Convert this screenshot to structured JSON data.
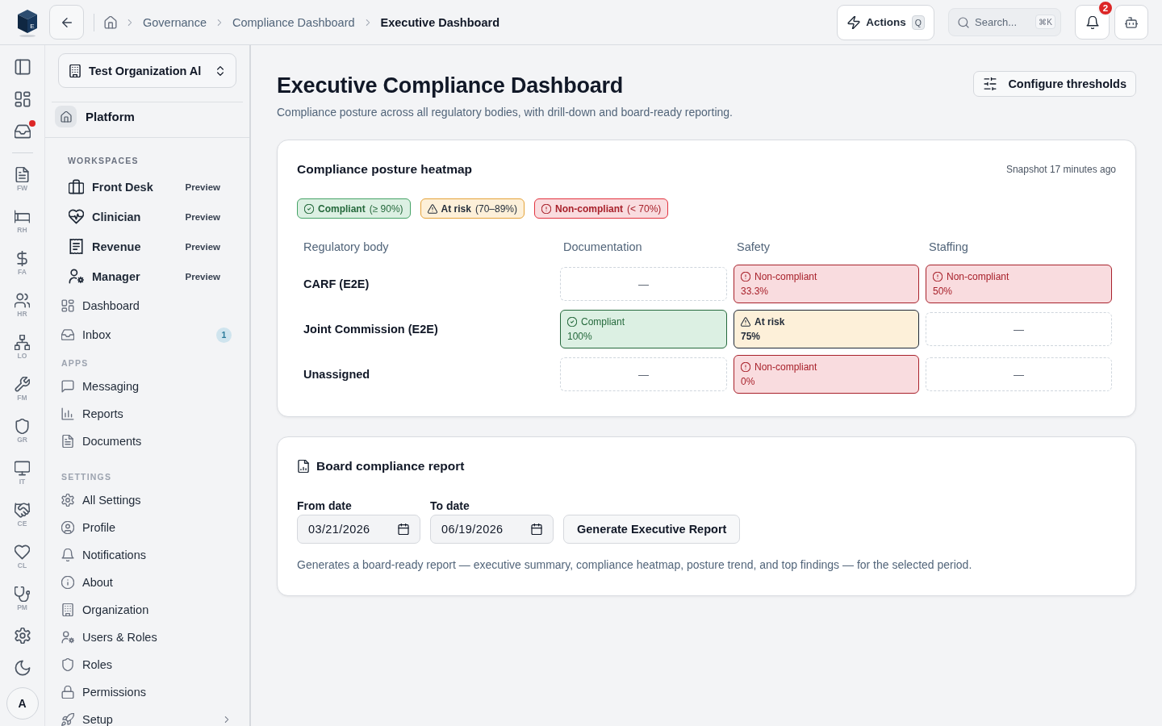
{
  "topbar": {
    "logo": "E",
    "breadcrumbs": [
      {
        "label": "Governance",
        "current": false
      },
      {
        "label": "Compliance Dashboard",
        "current": false
      },
      {
        "label": "Executive Dashboard",
        "current": true
      }
    ],
    "actions": {
      "label": "Actions",
      "shortcut": "Q"
    },
    "search": {
      "placeholder": "Search...",
      "shortcut": "⌘K"
    },
    "notifications": {
      "count": "2"
    }
  },
  "rail": {
    "inbox_unread": true,
    "apps": [
      {
        "label": "FW"
      },
      {
        "label": "RH"
      },
      {
        "label": "FA"
      },
      {
        "label": "HR"
      },
      {
        "label": "LO"
      },
      {
        "label": "FM"
      },
      {
        "label": "GR"
      },
      {
        "label": "IT"
      },
      {
        "label": "CE"
      },
      {
        "label": "CL"
      },
      {
        "label": "PM"
      }
    ],
    "avatar": "A"
  },
  "sidebar": {
    "organization": "Test Organization Al",
    "platform": "Platform",
    "workspaces": {
      "heading": "WORKSPACES",
      "items": [
        {
          "label": "Front Desk",
          "tag": "Preview"
        },
        {
          "label": "Clinician",
          "tag": "Preview"
        },
        {
          "label": "Revenue",
          "tag": "Preview"
        },
        {
          "label": "Manager",
          "tag": "Preview"
        }
      ]
    },
    "nav": [
      {
        "label": "Dashboard"
      },
      {
        "label": "Inbox",
        "badge": "1"
      }
    ],
    "sections": [
      {
        "heading": "APPS",
        "items": [
          {
            "label": "Messaging"
          },
          {
            "label": "Reports"
          },
          {
            "label": "Documents"
          }
        ]
      },
      {
        "heading": "SETTINGS",
        "items": [
          {
            "label": "All Settings"
          },
          {
            "label": "Profile"
          },
          {
            "label": "Notifications"
          },
          {
            "label": "About"
          },
          {
            "label": "Organization"
          },
          {
            "label": "Users & Roles"
          },
          {
            "label": "Roles"
          },
          {
            "label": "Permissions"
          },
          {
            "label": "Setup",
            "expanded": false
          }
        ]
      }
    ]
  },
  "page": {
    "title": "Executive Compliance Dashboard",
    "subtitle": "Compliance posture across all regulatory bodies, with drill-down and board-ready reporting.",
    "configure_button": "Configure thresholds"
  },
  "heatmap": {
    "title": "Compliance posture heatmap",
    "snapshot": "Snapshot 17 minutes ago",
    "legend": [
      {
        "kind": "compliant",
        "label": "Compliant",
        "range": "(≥ 90%)"
      },
      {
        "kind": "at_risk",
        "label": "At risk",
        "range": "(70–89%)"
      },
      {
        "kind": "noncompliant",
        "label": "Non-compliant",
        "range": "(< 70%)"
      }
    ],
    "row_header": "Regulatory body",
    "columns": [
      "Documentation",
      "Safety",
      "Staffing"
    ],
    "rows": [
      {
        "name": "CARF (E2E)",
        "cells": [
          {
            "kind": "empty",
            "value": "—"
          },
          {
            "kind": "noncompliant",
            "label": "Non-compliant",
            "value": "33.3%"
          },
          {
            "kind": "noncompliant",
            "label": "Non-compliant",
            "value": "50%"
          }
        ]
      },
      {
        "name": "Joint Commission (E2E)",
        "cells": [
          {
            "kind": "compliant",
            "label": "Compliant",
            "value": "100%"
          },
          {
            "kind": "at_risk",
            "label": "At risk",
            "value": "75%"
          },
          {
            "kind": "empty",
            "value": "—"
          }
        ]
      },
      {
        "name": "Unassigned",
        "cells": [
          {
            "kind": "empty",
            "value": "—"
          },
          {
            "kind": "noncompliant",
            "label": "Non-compliant",
            "value": "0%"
          },
          {
            "kind": "empty",
            "value": "—"
          }
        ]
      }
    ]
  },
  "report": {
    "title": "Board compliance report",
    "from": {
      "label": "From date",
      "value": "03/21/2026"
    },
    "to": {
      "label": "To date",
      "value": "06/19/2026"
    },
    "button": "Generate Executive Report",
    "description": "Generates a board-ready report — executive summary, compliance heatmap, posture trend, and top findings — for the selected period."
  }
}
